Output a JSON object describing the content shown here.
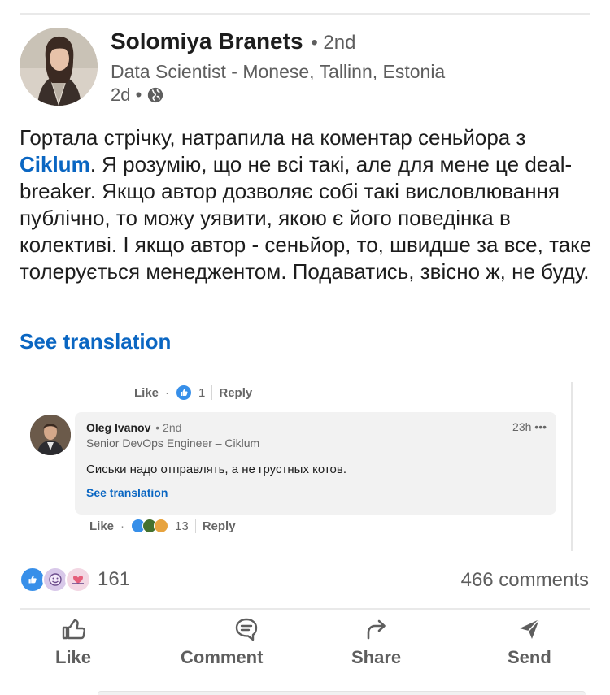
{
  "post": {
    "author": {
      "name": "Solomiya Branets",
      "degree": "• 2nd",
      "headline": "Data Scientist - Monese, Tallinn, Estonia",
      "time": "2d •",
      "visibility_icon": "globe-icon"
    },
    "body": {
      "part1": "Гортала стрічку, натрапила на коментар сеньйора з ",
      "mention": "Ciklum",
      "part2": ". Я розумію, що не всі такі, але для мене це deal-breaker. Якщо автор дозволяє собі такі висловлювання публічно, то можу уявити, якою є його поведінка в колективі. І якщо автор - сеньйор, то, швидше за все, таке толерується менеджентом. Подаватись, звісно ж, не буду."
    },
    "see_translation": "See translation"
  },
  "embedded_screenshot": {
    "prev_comment_actions": {
      "like": "Like",
      "dot": "·",
      "reaction_count": "1",
      "reply": "Reply"
    },
    "comment": {
      "author": "Oleg Ivanov",
      "degree": "• 2nd",
      "headline": "Senior DevOps Engineer – Ciklum",
      "time": "23h •••",
      "text": "Сиськи надо отправлять, а не грустных котов.",
      "see_translation": "See translation"
    },
    "comment_actions": {
      "like": "Like",
      "dot": "·",
      "reaction_count": "13",
      "reply": "Reply"
    }
  },
  "social": {
    "reactions_count": "161",
    "reaction_icons": [
      "like-reaction-icon",
      "funny-reaction-icon",
      "support-reaction-icon"
    ],
    "comments": "466 comments"
  },
  "actions": {
    "like": "Like",
    "comment": "Comment",
    "share": "Share",
    "send": "Send"
  },
  "colors": {
    "link": "#0a66c2",
    "text": "#1d1d1d",
    "muted": "#5e5e5e"
  }
}
